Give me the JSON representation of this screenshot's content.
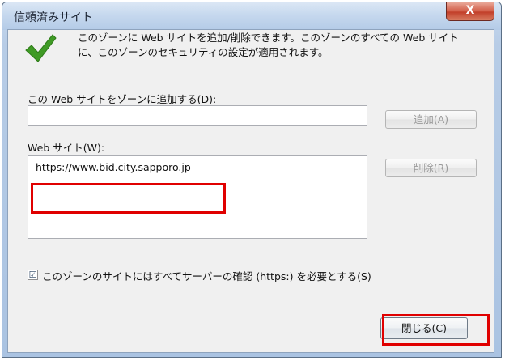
{
  "window": {
    "title": "信頼済みサイト",
    "close_glyph": "X"
  },
  "info": {
    "message": "このゾーンに Web サイトを追加/削除できます。このゾーンのすべての Web サイトに、このゾーンのセキュリティの設定が適用されます。"
  },
  "add_section": {
    "label": "この Web サイトをゾーンに追加する(D):",
    "input_value": "",
    "add_button": "追加(A)"
  },
  "sites_section": {
    "label": "Web サイト(W):",
    "items": [
      "https://www.bid.city.sapporo.jp"
    ],
    "remove_button": "削除(R)"
  },
  "https_option": {
    "checked": true,
    "check_glyph": "☑",
    "label": "このゾーンのサイトにはすべてサーバーの確認 (https:) を必要とする(S)"
  },
  "footer": {
    "close_button": "閉じる(C)"
  },
  "colors": {
    "highlight": "#e00000",
    "check_green": "#3f9a25"
  }
}
